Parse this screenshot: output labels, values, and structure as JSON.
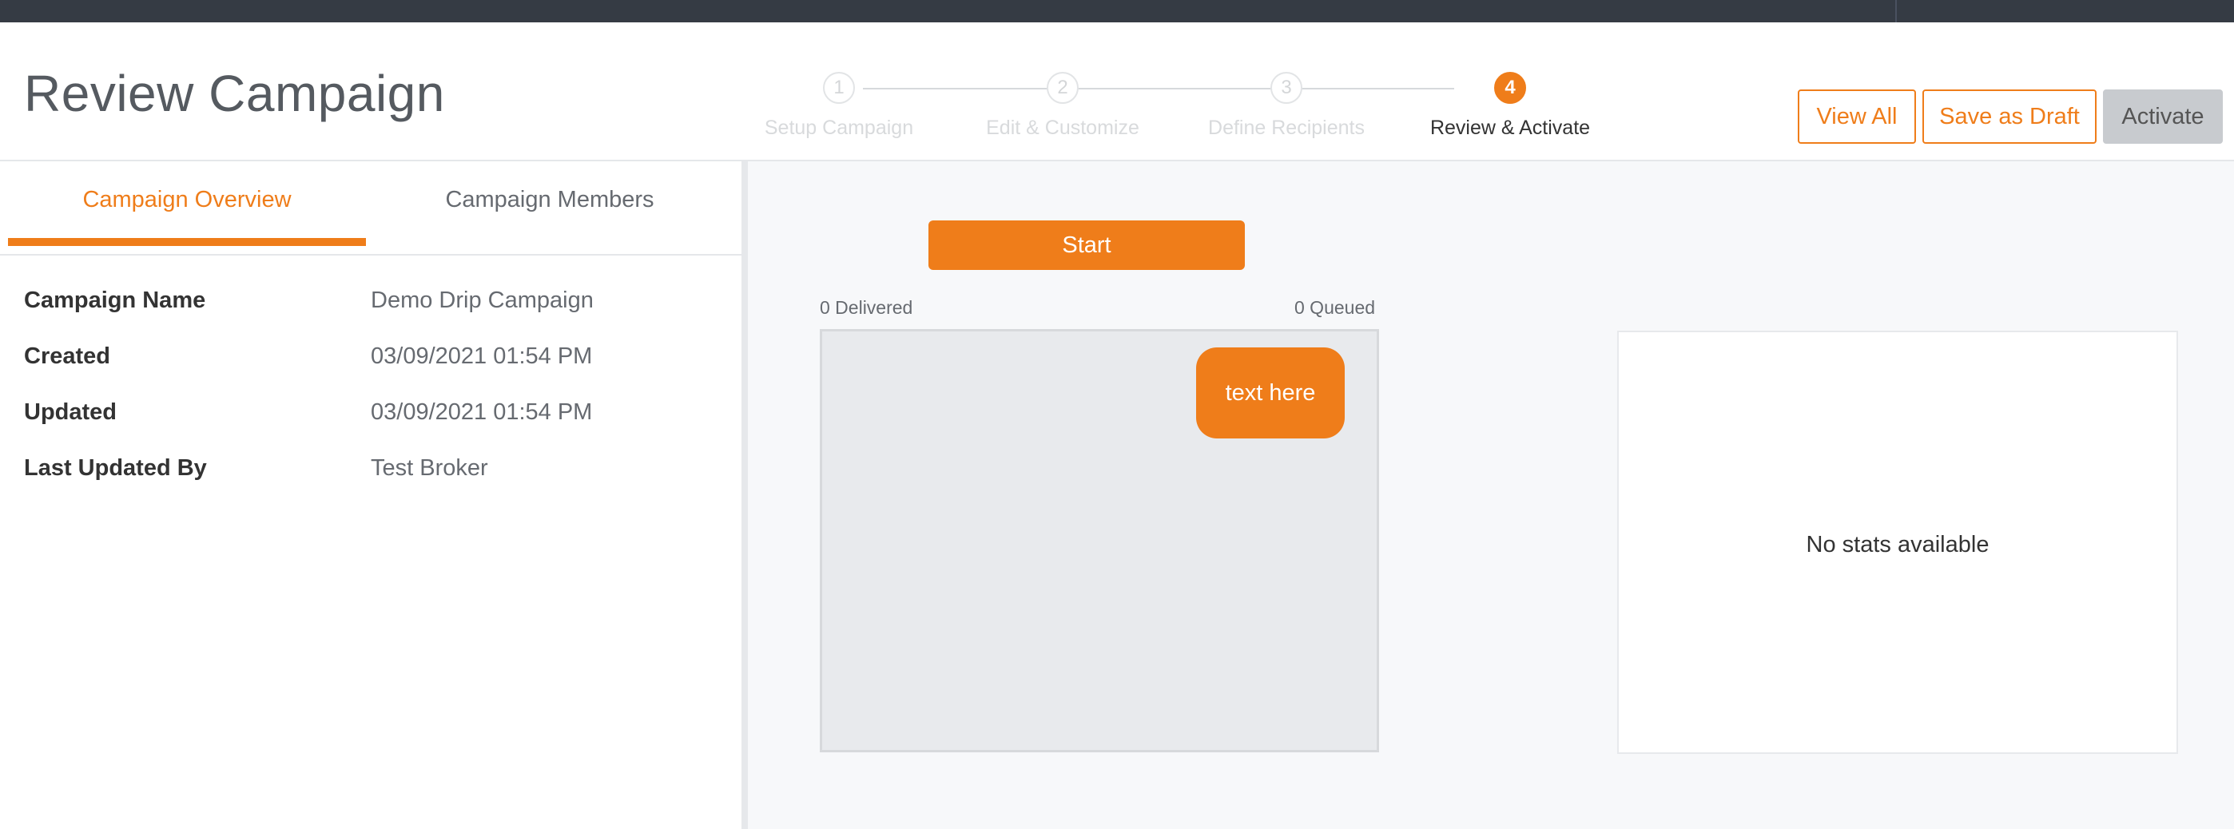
{
  "header": {
    "title": "Review Campaign",
    "steps": [
      {
        "number": "1",
        "label": "Setup Campaign"
      },
      {
        "number": "2",
        "label": "Edit & Customize"
      },
      {
        "number": "3",
        "label": "Define Recipients"
      },
      {
        "number": "4",
        "label": "Review & Activate"
      }
    ],
    "buttons": {
      "view_all": "View All",
      "save_draft": "Save as Draft",
      "activate": "Activate"
    }
  },
  "tabs": {
    "overview": "Campaign Overview",
    "members": "Campaign Members"
  },
  "overview": {
    "rows": [
      {
        "label": "Campaign Name",
        "value": "Demo Drip Campaign"
      },
      {
        "label": "Created",
        "value": "03/09/2021 01:54 PM"
      },
      {
        "label": "Updated",
        "value": "03/09/2021 01:54 PM"
      },
      {
        "label": "Last Updated By",
        "value": "Test Broker"
      }
    ]
  },
  "flow": {
    "start_label": "Start",
    "delivered": "0 Delivered",
    "queued": "0 Queued",
    "node_text": "text here"
  },
  "stats": {
    "empty_message": "No stats available"
  },
  "colors": {
    "accent": "#ef7d1a",
    "topbar": "#353b44"
  }
}
